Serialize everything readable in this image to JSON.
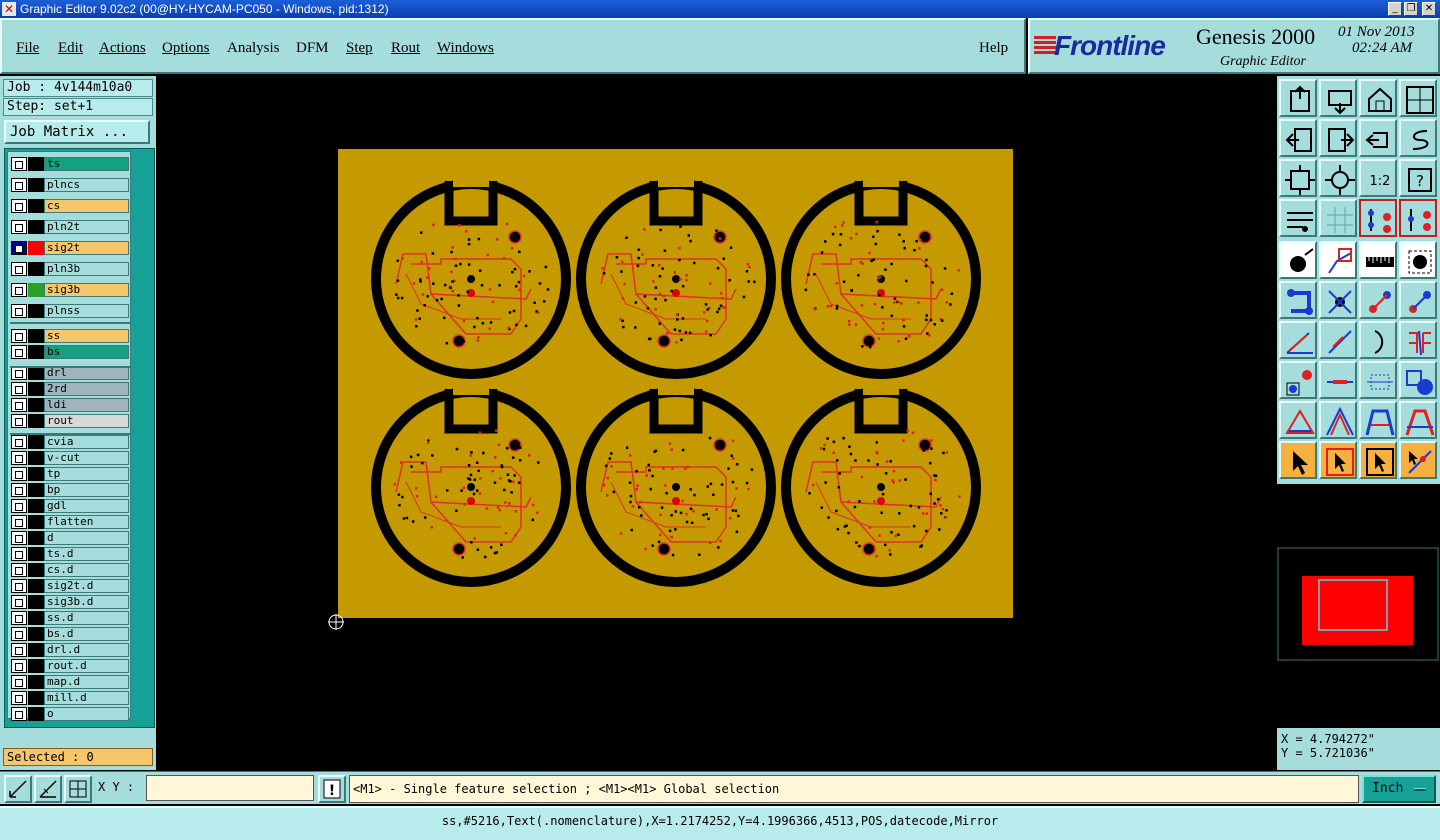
{
  "window": {
    "title": "Graphic Editor 9.02c2 (00@HY-HYCAM-PC050 - Windows, pid:1312)"
  },
  "menubar": {
    "items": [
      "File",
      "Edit",
      "Actions",
      "Options",
      "Analysis",
      "DFM",
      "Step",
      "Rout",
      "Windows"
    ],
    "help": "Help"
  },
  "logo": {
    "brand": "Frontline",
    "product": "Genesis 2000",
    "subtitle": "Graphic Editor",
    "date": "01 Nov 2013",
    "time": "02:24 AM"
  },
  "job": {
    "job_label": "Job : 4v144m10a0",
    "step_label": "Step: set+1",
    "matrix_button": "Job Matrix ..."
  },
  "layers": [
    {
      "name": "ts",
      "color": "#17a080",
      "swatch": ""
    },
    {
      "name": "plncs",
      "color": "#a5dcdc",
      "swatch": ""
    },
    {
      "name": "cs",
      "color": "#f5c66a",
      "swatch": ""
    },
    {
      "name": "pln2t",
      "color": "#a5dcdc",
      "swatch": ""
    },
    {
      "name": "sig2t",
      "color": "#f5c66a",
      "swatch": "#ff0000",
      "active": true
    },
    {
      "name": "pln3b",
      "color": "#a5dcdc",
      "swatch": ""
    },
    {
      "name": "sig3b",
      "color": "#f5c66a",
      "swatch": "#2aa02a"
    },
    {
      "name": "plnss",
      "color": "#a5dcdc",
      "swatch": ""
    },
    {
      "name": "ss",
      "color": "#f5c66a",
      "swatch": ""
    },
    {
      "name": "bs",
      "color": "#17a080",
      "swatch": ""
    },
    {
      "name": "drl",
      "color": "#a0b4bc",
      "swatch": ""
    },
    {
      "name": "2rd",
      "color": "#a0b4bc",
      "swatch": ""
    },
    {
      "name": "ldi",
      "color": "#a0b4bc",
      "swatch": ""
    },
    {
      "name": "rout",
      "color": "#d8d8d8",
      "swatch": ""
    },
    {
      "name": "cvia",
      "color": "#a5dcdc",
      "swatch": ""
    },
    {
      "name": "v-cut",
      "color": "#a5dcdc",
      "swatch": ""
    },
    {
      "name": "tp",
      "color": "#a5dcdc",
      "swatch": ""
    },
    {
      "name": "bp",
      "color": "#a5dcdc",
      "swatch": ""
    },
    {
      "name": "gdl",
      "color": "#a5dcdc",
      "swatch": ""
    },
    {
      "name": "flatten",
      "color": "#a5dcdc",
      "swatch": ""
    },
    {
      "name": "d",
      "color": "#a5dcdc",
      "swatch": ""
    },
    {
      "name": "ts.d",
      "color": "#a5dcdc",
      "swatch": ""
    },
    {
      "name": "cs.d",
      "color": "#a5dcdc",
      "swatch": ""
    },
    {
      "name": "sig2t.d",
      "color": "#a5dcdc",
      "swatch": ""
    },
    {
      "name": "sig3b.d",
      "color": "#a5dcdc",
      "swatch": ""
    },
    {
      "name": "ss.d",
      "color": "#a5dcdc",
      "swatch": ""
    },
    {
      "name": "bs.d",
      "color": "#a5dcdc",
      "swatch": ""
    },
    {
      "name": "drl.d",
      "color": "#a5dcdc",
      "swatch": ""
    },
    {
      "name": "rout.d",
      "color": "#a5dcdc",
      "swatch": ""
    },
    {
      "name": "map.d",
      "color": "#a5dcdc",
      "swatch": ""
    },
    {
      "name": "mill.d",
      "color": "#a5dcdc",
      "swatch": ""
    },
    {
      "name": "o",
      "color": "#a5dcdc",
      "swatch": ""
    }
  ],
  "selected_label": "Selected : 0",
  "coords": {
    "x": "X = 4.794272\"",
    "y": "Y = 5.721036\""
  },
  "bottom": {
    "xy_label": "X Y :",
    "xy_value": "",
    "message": "<M1> - Single feature selection ; <M1><M1> Global selection",
    "unit": "Inch"
  },
  "status": "ss,#5216,Text(.nomenclature),X=1.2174252,Y=4.1996366,4513,POS,datecode,Mirror",
  "colors": {
    "board": "#c49a00",
    "outline": "#000000",
    "trace": "#e03030",
    "ui_bg": "#a5dcdc",
    "preview_red": "#ff0000"
  }
}
